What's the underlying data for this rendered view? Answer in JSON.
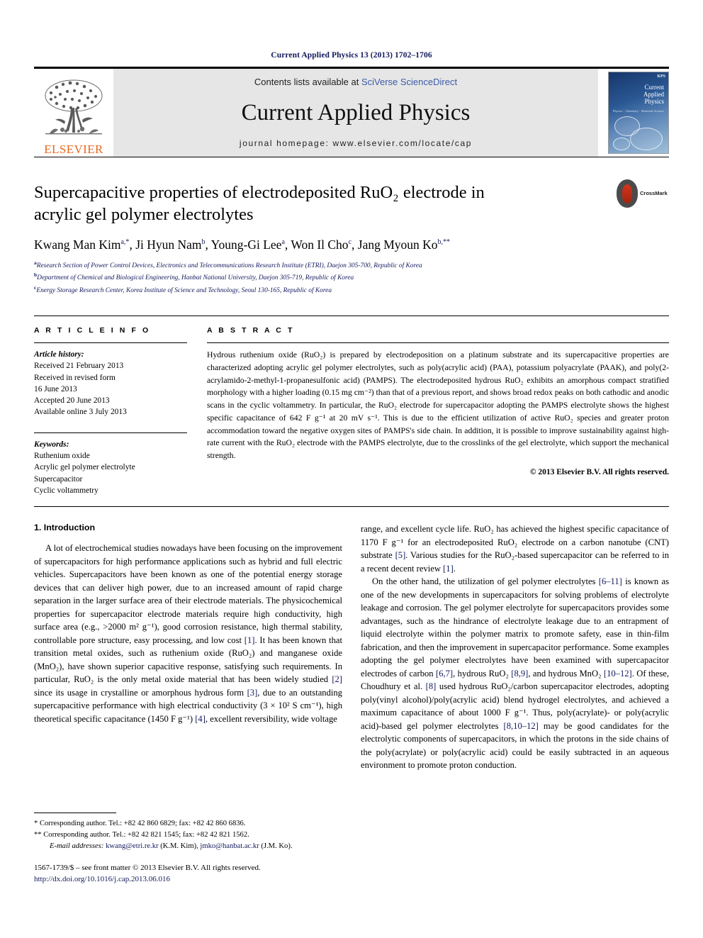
{
  "running_head": "Current Applied Physics 13 (2013) 1702–1706",
  "masthead": {
    "contents_prefix": "Contents lists available at ",
    "contents_link": "SciVerse ScienceDirect",
    "journal_title": "Current Applied Physics",
    "homepage": "journal homepage: www.elsevier.com/locate/cap",
    "publisher_logo_text": "ELSEVIER",
    "cover": {
      "title_line1": "Current",
      "title_line2": "Applied",
      "title_line3": "Physics",
      "subtitle": "Physics · Chemistry · Materials Science",
      "society_mark": "KPS"
    }
  },
  "article": {
    "title": "Supercapacitive properties of electrodeposited RuO₂ electrode in acrylic gel polymer electrolytes",
    "crossmark_label": "CrossMark",
    "authors_html": "Kwang Man Kim<sup>a,*</sup>, Ji Hyun Nam<sup>b</sup>, Young-Gi Lee<sup>a</sup>, Won Il Cho<sup>c</sup>, Jang Myoun Ko<sup>b,**</sup>",
    "affiliations": [
      "Research Section of Power Control Devices, Electronics and Telecommunications Research Institute (ETRI), Daejon 305-700, Republic of Korea",
      "Department of Chemical and Biological Engineering, Hanbat National University, Daejon 305-719, Republic of Korea",
      "Energy Storage Research Center, Korea Institute of Science and Technology, Seoul 130-165, Republic of Korea"
    ],
    "affiliation_marks": [
      "a",
      "b",
      "c"
    ]
  },
  "article_info": {
    "heading": "A R T I C L E   I N F O",
    "history_label": "Article history:",
    "history": [
      "Received 21 February 2013",
      "Received in revised form",
      "16 June 2013",
      "Accepted 20 June 2013",
      "Available online 3 July 2013"
    ],
    "keywords_label": "Keywords:",
    "keywords": [
      "Ruthenium oxide",
      "Acrylic gel polymer electrolyte",
      "Supercapacitor",
      "Cyclic voltammetry"
    ]
  },
  "abstract": {
    "heading": "A B S T R A C T",
    "text": "Hydrous ruthenium oxide (RuO₂) is prepared by electrodeposition on a platinum substrate and its supercapacitive properties are characterized adopting acrylic gel polymer electrolytes, such as poly(acrylic acid) (PAA), potassium polyacrylate (PAAK), and poly(2-acrylamido-2-methyl-1-propanesulfonic acid) (PAMPS). The electrodeposited hydrous RuO₂ exhibits an amorphous compact stratified morphology with a higher loading (0.15 mg cm⁻²) than that of a previous report, and shows broad redox peaks on both cathodic and anodic scans in the cyclic voltammetry. In particular, the RuO₂ electrode for supercapacitor adopting the PAMPS electrolyte shows the highest specific capacitance of 642 F g⁻¹ at 20 mV s⁻¹. This is due to the efficient utilization of active RuO₂ species and greater proton accommodation toward the negative oxygen sites of PAMPS's side chain. In addition, it is possible to improve sustainability against high-rate current with the RuO₂ electrode with the PAMPS electrolyte, due to the crosslinks of the gel electrolyte, which support the mechanical strength.",
    "copyright": "© 2013 Elsevier B.V. All rights reserved."
  },
  "body": {
    "section_title": "1. Introduction",
    "left_paragraph_1": "A lot of electrochemical studies nowadays have been focusing on the improvement of supercapacitors for high performance applications such as hybrid and full electric vehicles. Supercapacitors have been known as one of the potential energy storage devices that can deliver high power, due to an increased amount of rapid charge separation in the larger surface area of their electrode materials. The physicochemical properties for supercapacitor electrode materials require high conductivity, high surface area (e.g., >2000 m² g⁻¹), good corrosion resistance, high thermal stability, controllable pore structure, easy processing, and low cost [1]. It has been known that transition metal oxides, such as ruthenium oxide (RuO₂) and manganese oxide (MnO₂), have shown superior capacitive response, satisfying such requirements. In particular, RuO₂ is the only metal oxide material that has been widely studied [2] since its usage in crystalline or amorphous hydrous form [3], due to an outstanding supercapacitive performance with high electrical conductivity (3 × 10² S cm⁻¹), high theoretical specific capacitance (1450 F g⁻¹) [4], excellent reversibility, wide voltage",
    "right_paragraph_1": "range, and excellent cycle life. RuO₂ has achieved the highest specific capacitance of 1170 F g⁻¹ for an electrodeposited RuO₂ electrode on a carbon nanotube (CNT) substrate [5]. Various studies for the RuO₂-based supercapacitor can be referred to in a recent decent review [1].",
    "right_paragraph_2": "On the other hand, the utilization of gel polymer electrolytes [6–11] is known as one of the new developments in supercapacitors for solving problems of electrolyte leakage and corrosion. The gel polymer electrolyte for supercapacitors provides some advantages, such as the hindrance of electrolyte leakage due to an entrapment of liquid electrolyte within the polymer matrix to promote safety, ease in thin-film fabrication, and then the improvement in supercapacitor performance. Some examples adopting the gel polymer electrolytes have been examined with supercapacitor electrodes of carbon [6,7], hydrous RuO₂ [8,9], and hydrous MnO₂ [10–12]. Of these, Choudhury et al. [8] used hydrous RuO₂/carbon supercapacitor electrodes, adopting poly(vinyl alcohol)/poly(acrylic acid) blend hydrogel electrolytes, and achieved a maximum capacitance of about 1000 F g⁻¹. Thus, poly(acrylate)- or poly(acrylic acid)-based gel polymer electrolytes [8,10–12] may be good candidates for the electrolytic components of supercapacitors, in which the protons in the side chains of the poly(acrylate) or poly(acrylic acid) could be easily subtracted in an aqueous environment to promote proton conduction."
  },
  "footnotes": {
    "corresponding_1": "* Corresponding author. Tel.: +82 42 860 6829; fax: +82 42 860 6836.",
    "corresponding_2": "** Corresponding author. Tel.: +82 42 821 1545; fax: +82 42 821 1562.",
    "email_label": "E-mail addresses:",
    "email_1": "kwang@etri.re.kr",
    "email_1_owner": "(K.M. Kim),",
    "email_2": "jmko@hanbat.ac.kr",
    "email_2_owner": "(J.M. Ko)."
  },
  "imprint": {
    "line1": "1567-1739/$ – see front matter © 2013 Elsevier B.V. All rights reserved.",
    "doi": "http://dx.doi.org/10.1016/j.cap.2013.06.016"
  },
  "colors": {
    "link_blue": "#3b5aa8",
    "ref_blue": "#12195c",
    "elsevier_orange": "#e8681f",
    "masthead_gray": "#e6e6e6"
  }
}
